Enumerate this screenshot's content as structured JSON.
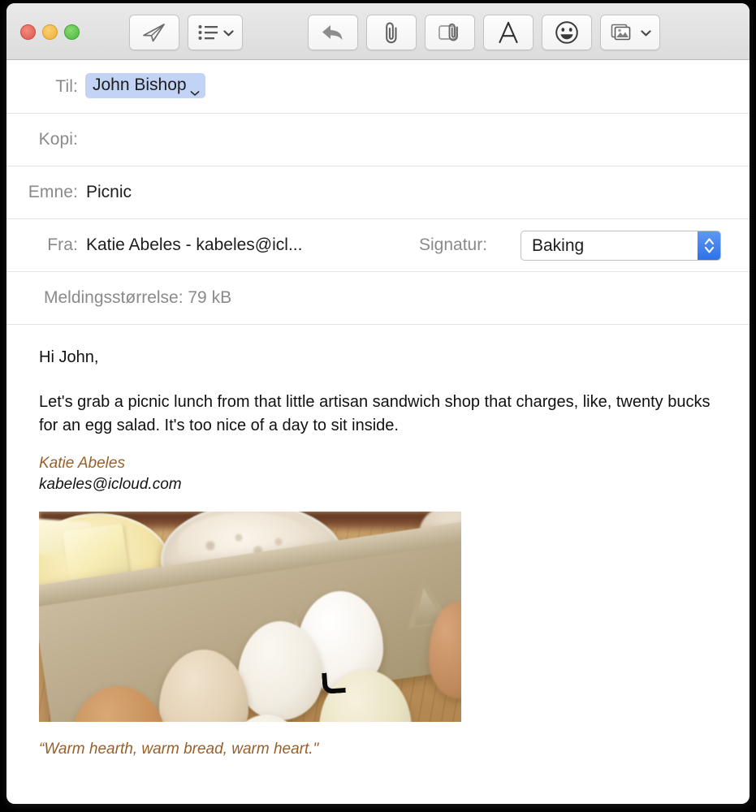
{
  "window": {
    "traffic_lights": [
      {
        "name": "close",
        "color": "#e0564a"
      },
      {
        "name": "minimize",
        "color": "#eeae35"
      },
      {
        "name": "zoom",
        "color": "#4cb83d"
      }
    ]
  },
  "toolbar": {
    "buttons": [
      {
        "id": "send",
        "icon": "paper-plane-icon",
        "label": "",
        "has_chevron": false
      },
      {
        "id": "header-list",
        "icon": "bulleted-list-icon",
        "label": "",
        "has_chevron": true
      },
      {
        "id": "reply",
        "icon": "reply-arrow-icon",
        "label": "",
        "has_chevron": false
      },
      {
        "id": "attach",
        "icon": "paperclip-icon",
        "label": "",
        "has_chevron": false
      },
      {
        "id": "markup",
        "icon": "attachment-markup-icon",
        "label": "",
        "has_chevron": false
      },
      {
        "id": "format",
        "icon": "format-text-a-icon",
        "label": "A",
        "has_chevron": false
      },
      {
        "id": "emoji",
        "icon": "smiley-face-icon",
        "label": "",
        "has_chevron": false
      },
      {
        "id": "photos",
        "icon": "photo-browser-icon",
        "label": "",
        "has_chevron": true
      }
    ]
  },
  "compose": {
    "to": {
      "label": "Til:",
      "recipient_token": "John Bishop",
      "token_color": "#c3d3f6"
    },
    "cc": {
      "label": "Kopi:",
      "value": ""
    },
    "subject": {
      "label": "Emne:",
      "value": "Picnic"
    },
    "from": {
      "label": "Fra:",
      "value": "Katie Abeles - kabeles@icl..."
    },
    "signature": {
      "label": "Signatur:",
      "selected": "Baking",
      "stepper_color": "#2f72e8"
    },
    "message_size": "Meldingsstørrelse: 79 kB"
  },
  "message": {
    "greeting": "Hi John,",
    "paragraph": "Let's grab a picnic lunch from that little artisan sandwich shop that charges, like, twenty bucks for an egg salad. It's too nice of a day to sit inside.",
    "signature_name": "Katie Abeles",
    "signature_email": "kabeles@icloud.com",
    "signature_name_color": "#9a5f28",
    "image_alt": "Photo of butter and flour in glass bowls beside a carton of eggs on a wooden table",
    "quote": "“Warm hearth, warm bread, warm heart.\""
  }
}
